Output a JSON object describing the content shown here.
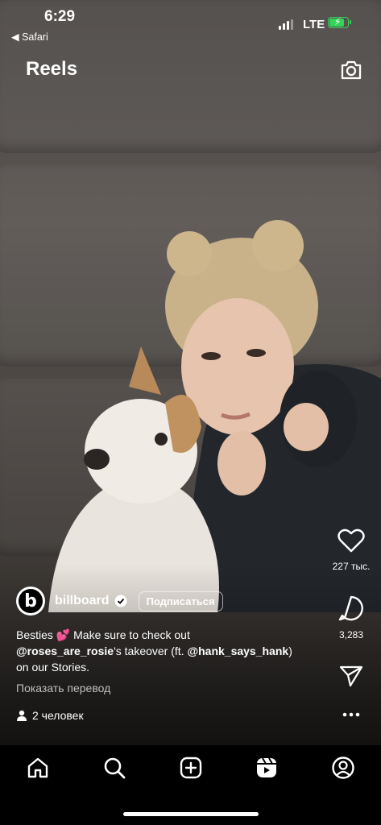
{
  "status_bar": {
    "time": "6:29",
    "back_app": "◀ Safari",
    "network": "LTE",
    "battery_level": 0.85,
    "battery_color": "#36d35a"
  },
  "header": {
    "title": "Reels",
    "camera_icon": "camera-icon"
  },
  "actions": {
    "likes": "227 тыс.",
    "comments": "3,283",
    "like_icon": "heart-icon",
    "comment_icon": "comment-icon",
    "share_icon": "send-icon",
    "more_icon": "more-icon"
  },
  "post": {
    "author_initial": "b",
    "author": "billboard",
    "verified": true,
    "follow_label": "Подписаться",
    "caption_part1": "Besties 💕 Make sure to check out",
    "mention1": "@roses_are_rosie",
    "caption_part2": "'s takeover (ft. ",
    "mention2": "@hank_says_hank",
    "caption_part3": ")",
    "caption_line3": "on our Stories.",
    "translate_label": "Показать перевод",
    "people_count": "2 человек"
  },
  "nav": {
    "items": [
      "home-icon",
      "search-icon",
      "create-icon",
      "reels-icon",
      "profile-icon"
    ]
  }
}
